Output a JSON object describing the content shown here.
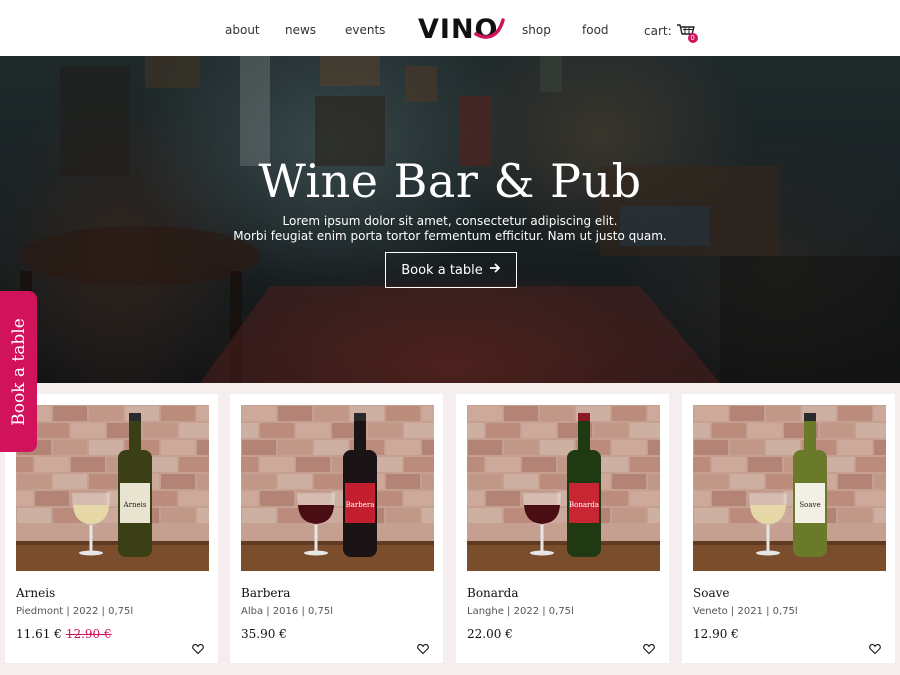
{
  "nav": {
    "links_left": [
      "about",
      "news",
      "events"
    ],
    "logo": "VINO",
    "links_right": [
      "shop",
      "food"
    ],
    "cart_label": "cart:",
    "cart_count": "0",
    "accent": "#d1135c"
  },
  "hero": {
    "title": "Wine Bar & Pub",
    "subtitle_line1": "Lorem ipsum dolor sit amet, consectetur adipiscing elit.",
    "subtitle_line2": "Morbi feugiat enim porta tortor fermentum efficitur. Nam ut justo quam.",
    "cta_label": "Book a table",
    "cta_icon": "arrow-right-icon"
  },
  "side_tab": {
    "label": "Book a table"
  },
  "products": [
    {
      "name": "Arneis",
      "meta": "Piedmont | 2022 | 0,75l",
      "price": "11.61 €",
      "old_price": "12.90 €",
      "bottle_label": "Arneis",
      "wine": "white"
    },
    {
      "name": "Barbera",
      "meta": "Alba | 2016 | 0,75l",
      "price": "35.90 €",
      "old_price": "",
      "bottle_label": "Barbera",
      "wine": "red"
    },
    {
      "name": "Bonarda",
      "meta": "Langhe | 2022 | 0,75l",
      "price": "22.00 €",
      "old_price": "",
      "bottle_label": "Bonarda",
      "wine": "red"
    },
    {
      "name": "Soave",
      "meta": "Veneto | 2021 | 0,75l",
      "price": "12.90 €",
      "old_price": "",
      "bottle_label": "Soave",
      "wine": "white"
    }
  ]
}
